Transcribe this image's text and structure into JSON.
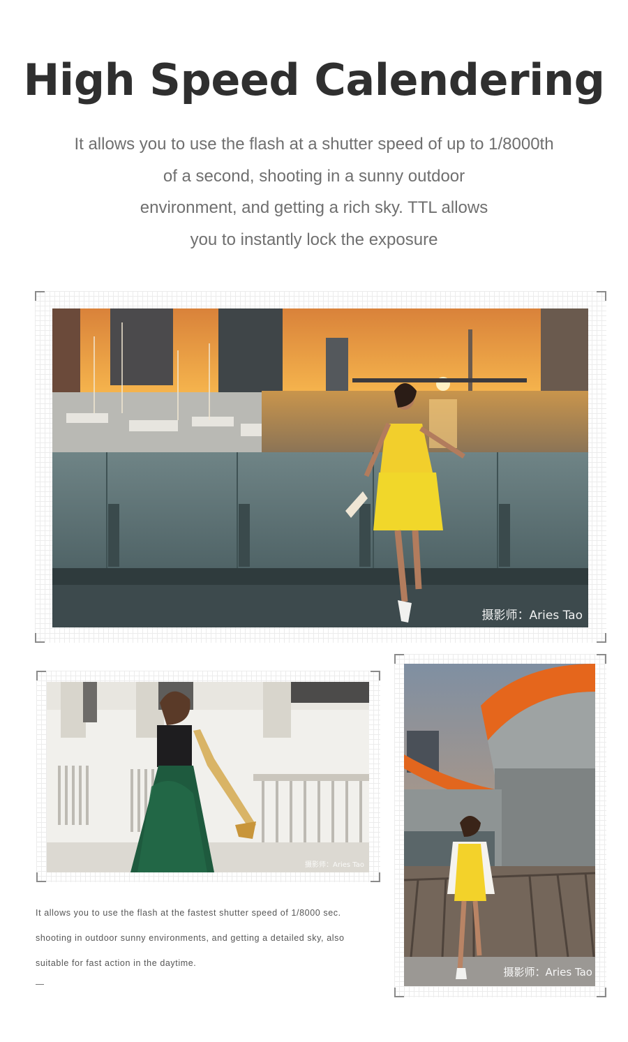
{
  "header": {
    "title": "High Speed Calendering",
    "subtitle_lines": [
      "It allows you to use the flash at a shutter speed of up to 1/8000th",
      "of a second, shooting in a sunny outdoor",
      "environment, and getting a rich sky. TTL allows",
      "you to instantly lock the exposure"
    ]
  },
  "photos": {
    "main": {
      "credit": "摄影师：Aries Tao"
    },
    "left": {
      "credit": "摄影师：Aries Tao"
    },
    "right": {
      "credit": "摄影师：Aries Tao"
    }
  },
  "description": {
    "lines": [
      "It allows you to use the flash at the fastest shutter speed of 1/8000 sec.",
      "shooting in outdoor sunny environments, and getting a detailed sky, also",
      "suitable for fast action in the daytime."
    ],
    "dash": "—"
  }
}
